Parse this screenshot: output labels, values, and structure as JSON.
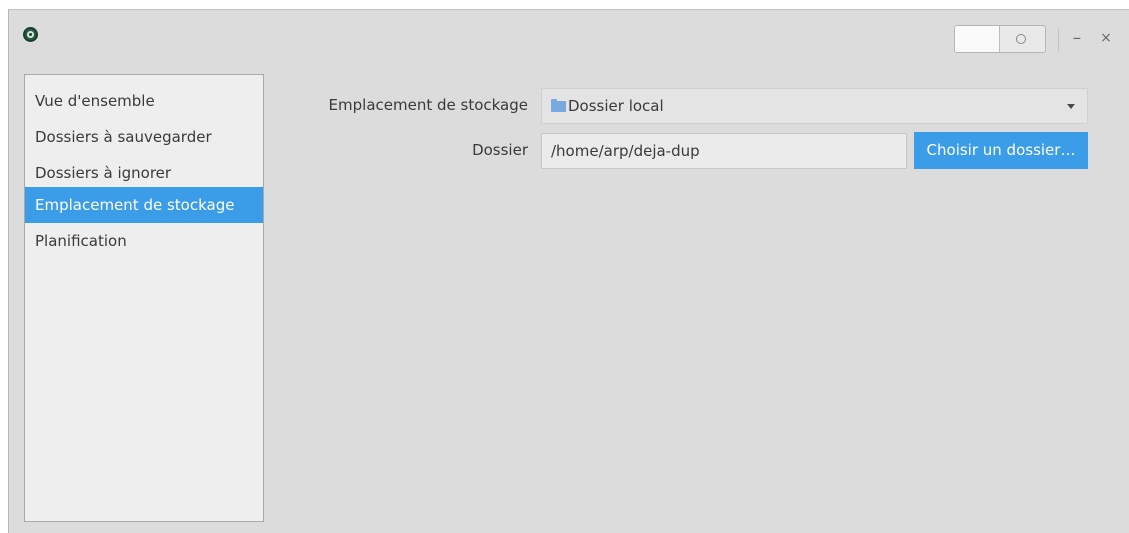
{
  "window": {
    "title_icon": "deja-dup-app-icon",
    "controls": {
      "mode_toggle_icon": "circle-toggle-icon",
      "minimize_label": "–",
      "close_label": "×"
    }
  },
  "sidebar": {
    "items": [
      {
        "label": "Vue d'ensemble",
        "selected": false
      },
      {
        "label": "Dossiers à sauvegarder",
        "selected": false
      },
      {
        "label": "Dossiers à ignorer",
        "selected": false
      },
      {
        "label": "Emplacement de stockage",
        "selected": true
      },
      {
        "label": "Planification",
        "selected": false
      }
    ]
  },
  "storage": {
    "location_label": "Emplacement de stockage",
    "location_value": "Dossier local",
    "location_icon": "folder-icon",
    "folder_label": "Dossier",
    "folder_value": "/home/arp/deja-dup",
    "choose_button_label": "Choisir un dossier…"
  },
  "colors": {
    "accent": "#3b9ce8",
    "window_bg": "#dcdcdc",
    "sidebar_bg": "#eeeeee",
    "text": "#3a3a3a"
  }
}
